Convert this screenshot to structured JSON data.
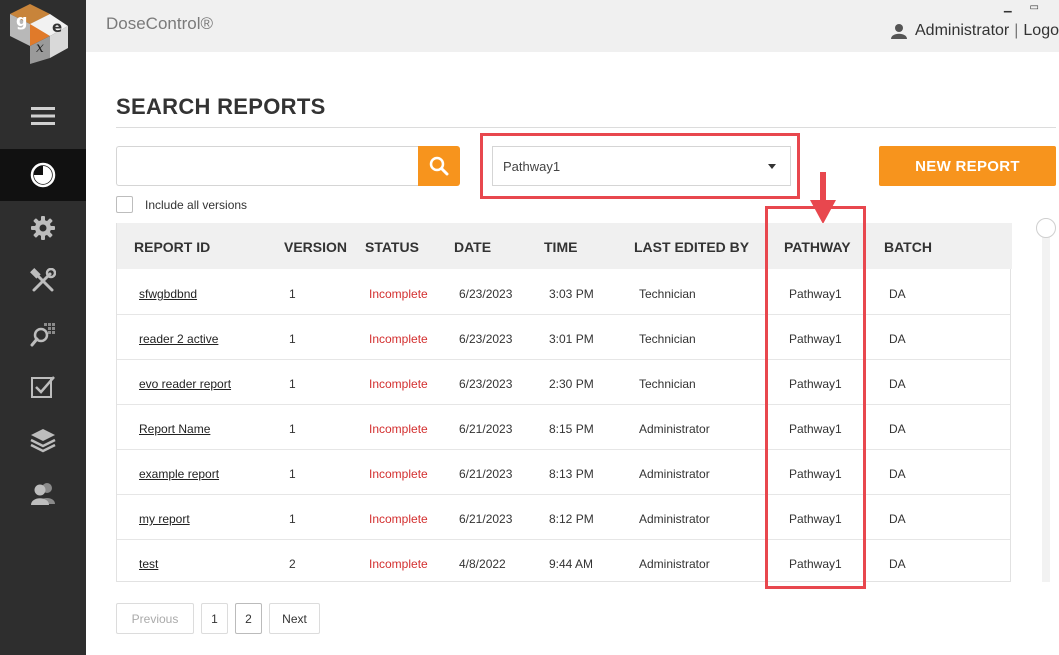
{
  "app": {
    "title": "DoseControl®",
    "logo_text": "gex"
  },
  "user": {
    "name": "Administrator",
    "separator": "|",
    "logout": "Logo"
  },
  "sidebar": {
    "items": [
      {
        "icon": "menu-icon"
      },
      {
        "icon": "dashboard-icon",
        "active": true
      },
      {
        "icon": "gear-icon"
      },
      {
        "icon": "tools-icon"
      },
      {
        "icon": "search-grid-icon"
      },
      {
        "icon": "checklist-icon"
      },
      {
        "icon": "layers-icon"
      },
      {
        "icon": "users-icon"
      }
    ]
  },
  "page": {
    "title": "SEARCH REPORTS"
  },
  "search": {
    "value": "",
    "placeholder": ""
  },
  "pathway_select": {
    "selected": "Pathway1"
  },
  "new_report_label": "NEW REPORT",
  "include_versions_label": "Include all versions",
  "table": {
    "columns": [
      "REPORT ID",
      "VERSION",
      "STATUS",
      "DATE",
      "TIME",
      "LAST EDITED BY",
      "PATHWAY",
      "BATCH"
    ],
    "rows": [
      {
        "id": "sfwgbdbnd",
        "version": "1",
        "status": "Incomplete",
        "date": "6/23/2023",
        "time": "3:03 PM",
        "editor": "Technician",
        "pathway": "Pathway1",
        "batch": "DA"
      },
      {
        "id": "reader 2 active",
        "version": "1",
        "status": "Incomplete",
        "date": "6/23/2023",
        "time": "3:01 PM",
        "editor": "Technician",
        "pathway": "Pathway1",
        "batch": "DA"
      },
      {
        "id": "evo reader report",
        "version": "1",
        "status": "Incomplete",
        "date": "6/23/2023",
        "time": "2:30 PM",
        "editor": "Technician",
        "pathway": "Pathway1",
        "batch": "DA"
      },
      {
        "id": "Report Name",
        "version": "1",
        "status": "Incomplete",
        "date": "6/21/2023",
        "time": "8:15 PM",
        "editor": "Administrator",
        "pathway": "Pathway1",
        "batch": "DA"
      },
      {
        "id": "example report",
        "version": "1",
        "status": "Incomplete",
        "date": "6/21/2023",
        "time": "8:13 PM",
        "editor": "Administrator",
        "pathway": "Pathway1",
        "batch": "DA"
      },
      {
        "id": "my report",
        "version": "1",
        "status": "Incomplete",
        "date": "6/21/2023",
        "time": "8:12 PM",
        "editor": "Administrator",
        "pathway": "Pathway1",
        "batch": "DA"
      },
      {
        "id": "test",
        "version": "2",
        "status": "Incomplete",
        "date": "4/8/2022",
        "time": "9:44 AM",
        "editor": "Administrator",
        "pathway": "Pathway1",
        "batch": "DA"
      }
    ]
  },
  "pagination": {
    "previous": "Previous",
    "pages": [
      "1",
      "2"
    ],
    "current": "2",
    "next": "Next"
  },
  "colors": {
    "accent": "#f7941d",
    "highlight": "#e8474e",
    "status_incomplete": "#d32f2f",
    "sidebar": "#2e2e2e"
  }
}
